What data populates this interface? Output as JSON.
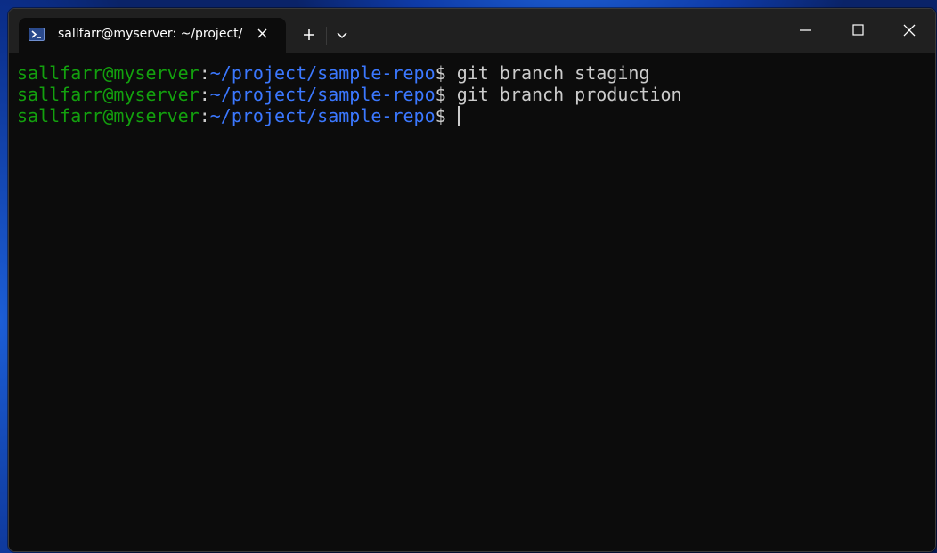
{
  "window": {
    "tab_title": "sallfarr@myserver: ~/project/",
    "tab_icon": "powershell-terminal-icon",
    "new_tab_icon": "plus-icon",
    "dropdown_icon": "chevron-down-icon",
    "controls": [
      "minimize-icon",
      "maximize-icon",
      "close-icon"
    ]
  },
  "terminal": {
    "colors": {
      "background": "#0c0c0c",
      "user": "#13a10e",
      "path": "#3b78ff",
      "text": "#cccccc"
    },
    "lines": [
      {
        "user": "sallfarr@myserver",
        "sep": ":",
        "path": "~/project/sample-repo",
        "dollar": "$",
        "command": " git branch staging"
      },
      {
        "user": "sallfarr@myserver",
        "sep": ":",
        "path": "~/project/sample-repo",
        "dollar": "$",
        "command": " git branch production"
      },
      {
        "user": "sallfarr@myserver",
        "sep": ":",
        "path": "~/project/sample-repo",
        "dollar": "$",
        "command": " "
      }
    ]
  }
}
